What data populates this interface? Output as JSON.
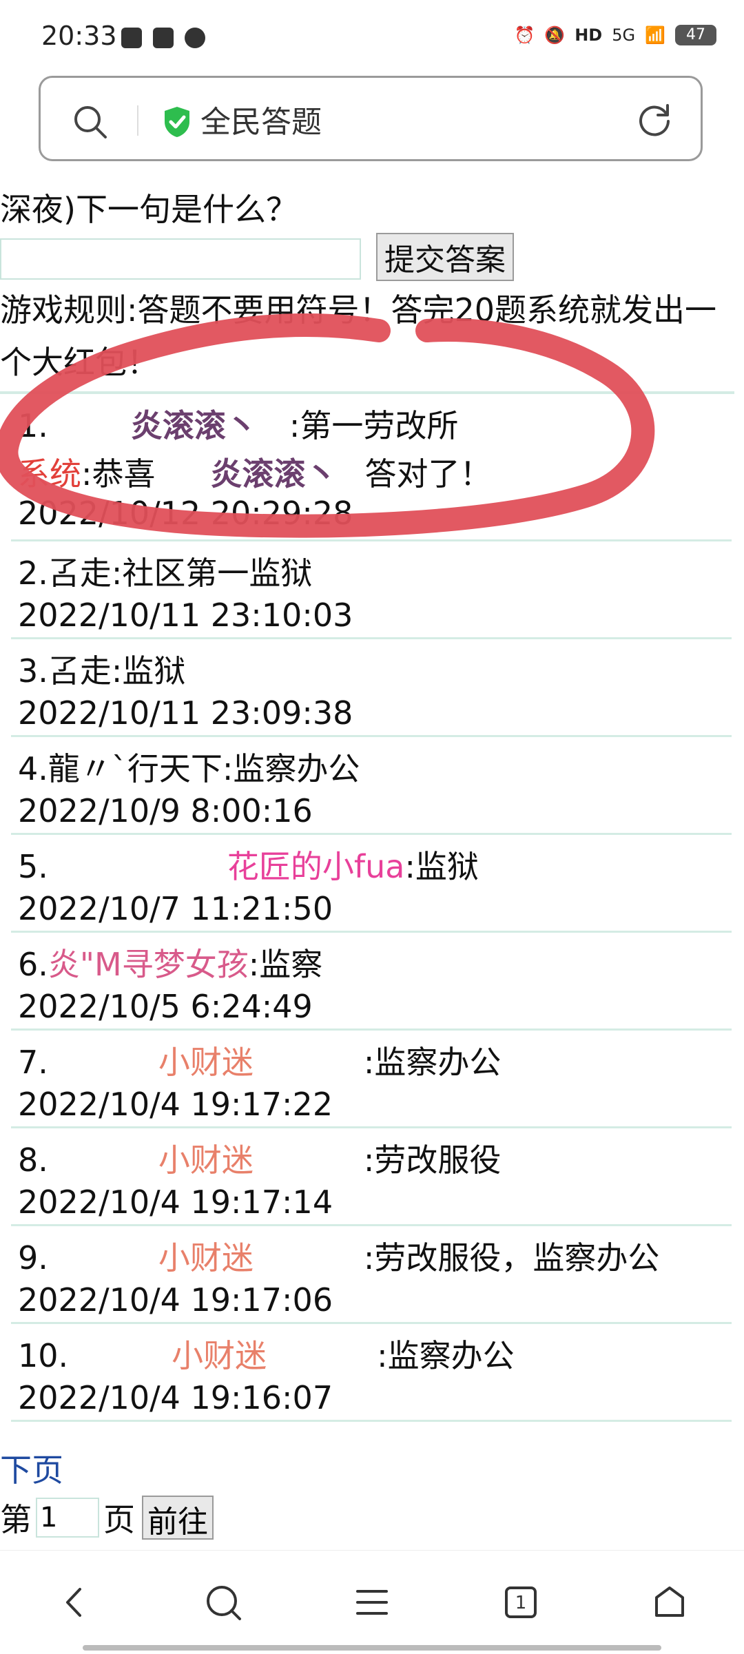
{
  "status_bar": {
    "time": "20:33",
    "network": "5G",
    "battery": "47"
  },
  "address_bar": {
    "title": "全民答题"
  },
  "quiz": {
    "question": "深夜)下一句是什么？",
    "input_value": "",
    "submit_label": "提交答案",
    "rules": "游戏规则:答题不要用符号！答完20题系统就发出一个大红包！"
  },
  "answers": [
    {
      "index": "1.",
      "nickname": "炎滚滚丶",
      "answer": ":第一劳改所",
      "system_label": "系统",
      "system_text_1": ":恭喜",
      "system_nickname": "炎滚滚丶",
      "system_text_2": "答对了！",
      "time": "2022/10/12 20:29:28"
    },
    {
      "index": "2.",
      "nickname": "叾走",
      "answer": ":社区第一监狱",
      "time": "2022/10/11 23:10:03"
    },
    {
      "index": "3.",
      "nickname": "叾走",
      "answer": ":监狱",
      "time": "2022/10/11 23:09:38"
    },
    {
      "index": "4.",
      "nickname": "龍〃ˋ行天下",
      "answer": ":监察办公",
      "time": "2022/10/9 8:00:16"
    },
    {
      "index": "5.",
      "nickname": "花匠的小fua",
      "answer": ":监狱",
      "time": "2022/10/7 11:21:50"
    },
    {
      "index": "6.",
      "nickname": "炎\"M寻梦女孩",
      "answer": ":监察",
      "time": "2022/10/5 6:24:49"
    },
    {
      "index": "7.",
      "nickname": "小财迷",
      "answer": ":监察办公",
      "time": "2022/10/4 19:17:22"
    },
    {
      "index": "8.",
      "nickname": "小财迷",
      "answer": ":劳改服役",
      "time": "2022/10/4 19:17:14"
    },
    {
      "index": "9.",
      "nickname": "小财迷",
      "answer": ":劳改服役，监察办公",
      "time": "2022/10/4 19:17:06"
    },
    {
      "index": "10.",
      "nickname": "小财迷",
      "answer": ":监察办公",
      "time": "2022/10/4 19:16:07"
    }
  ],
  "pagination": {
    "next_label": "下页",
    "prefix": "第",
    "page_value": "1",
    "suffix": "页",
    "go_label": "前往"
  },
  "colors": {
    "annotation": "#e0505a",
    "link": "#1f4aa0",
    "divider": "#d4ece4"
  },
  "icons": [
    "search-icon",
    "shield-check-icon",
    "reload-icon",
    "back-icon",
    "search-nav-icon",
    "menu-icon",
    "tabs-icon",
    "home-icon"
  ]
}
